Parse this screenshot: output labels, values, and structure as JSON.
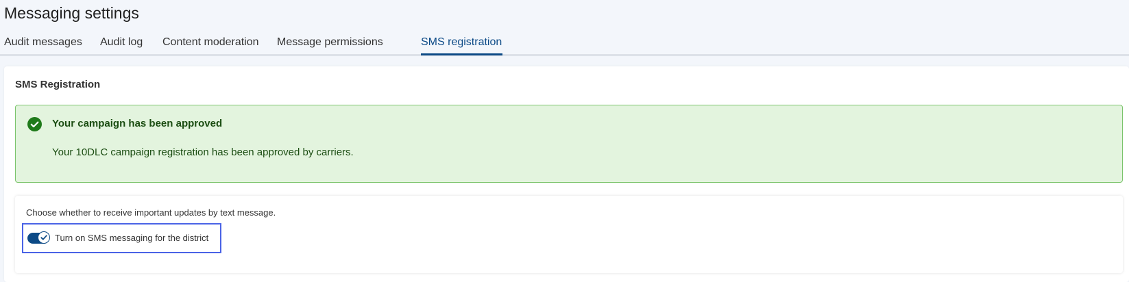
{
  "page": {
    "title": "Messaging settings"
  },
  "tabs": [
    {
      "label": "Audit messages",
      "active": false
    },
    {
      "label": "Audit log",
      "active": false
    },
    {
      "label": "Content moderation",
      "active": false
    },
    {
      "label": "Message permissions",
      "active": false
    },
    {
      "label": "SMS registration",
      "active": true
    }
  ],
  "card": {
    "title": "SMS Registration",
    "alert": {
      "icon": "check-circle-icon",
      "title": "Your campaign has been approved",
      "body": "Your 10DLC campaign registration has been approved by carriers."
    },
    "sms": {
      "description": "Choose whether to receive important updates by text message.",
      "toggle_label": "Turn on SMS messaging for the district",
      "toggle_on": true
    }
  },
  "colors": {
    "accent": "#0c4a86",
    "success_bg": "#e3f4de",
    "success_border": "#7bc46c",
    "success_text": "#1b4d12",
    "focus_ring": "#4a63e6"
  }
}
